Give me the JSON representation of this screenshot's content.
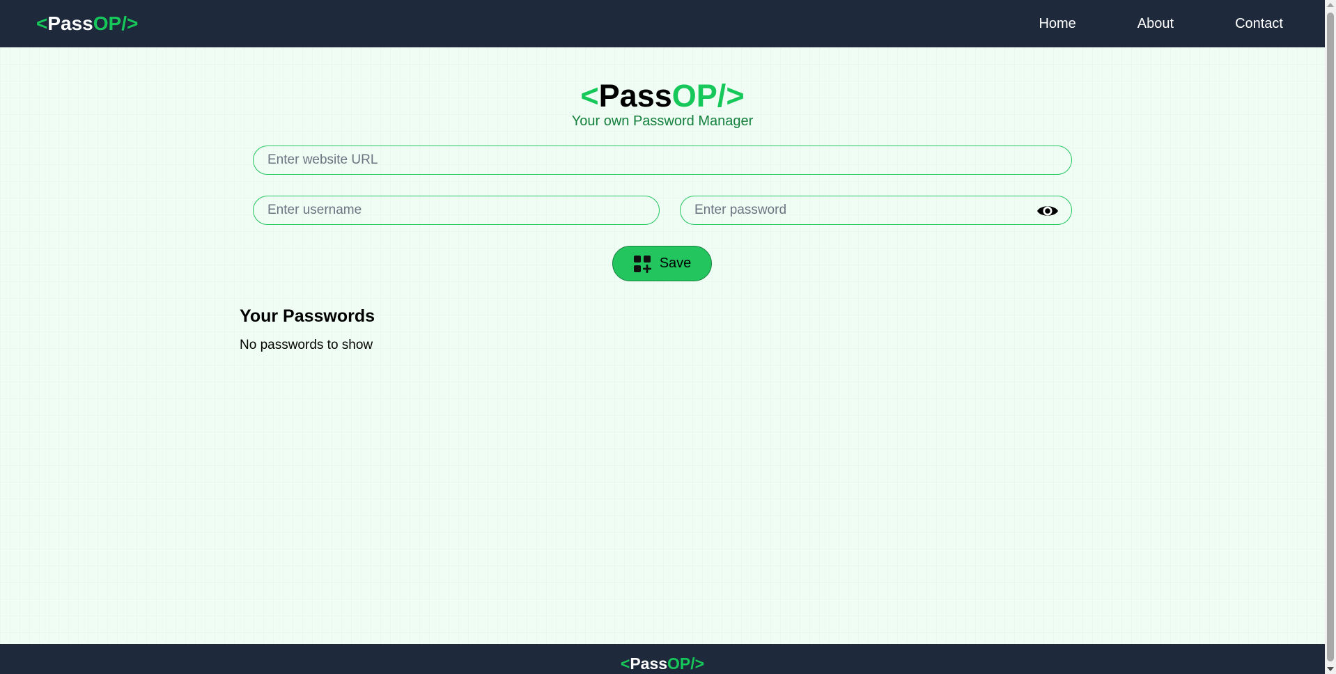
{
  "nav": {
    "logo": {
      "open": "<",
      "pass": "Pass",
      "op": "OP/",
      "close": ">"
    },
    "links": [
      "Home",
      "About",
      "Contact"
    ]
  },
  "hero": {
    "logo": {
      "open": "<",
      "pass": "Pass",
      "op": "OP/",
      "close": ">"
    },
    "subtitle": "Your own Password Manager"
  },
  "form": {
    "url_placeholder": "Enter website URL",
    "username_placeholder": "Enter username",
    "password_placeholder": "Enter password",
    "save_label": "Save"
  },
  "passwords": {
    "title": "Your Passwords",
    "empty_text": "No passwords to show"
  },
  "footer": {
    "logo": {
      "open": "<",
      "pass": "Pass",
      "op": "OP/",
      "close": ">"
    }
  },
  "colors": {
    "nav_bg": "#1e293b",
    "accent": "#22c55e",
    "page_bg": "#f0fdf4"
  },
  "icons": {
    "eye": "eye-icon",
    "save": "grid-plus-icon"
  }
}
